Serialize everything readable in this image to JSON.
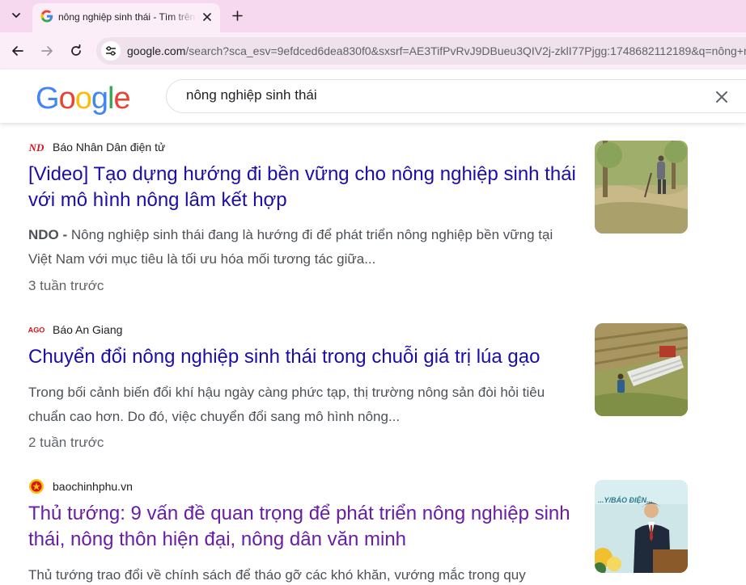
{
  "browser": {
    "tab_title": "nông nghiệp sinh thái - Tìm trên Google",
    "url_host": "google.com",
    "url_rest": "/search?sca_esv=9efdced6dea830f0&sxsrf=AE3TifPvRvJ9DBueu3QIV2j-zklI77Pjgg:1748682112189&q=nông+nghiệp"
  },
  "google": {
    "logo_letters": [
      "G",
      "o",
      "o",
      "g",
      "l",
      "e"
    ],
    "logo_colors": [
      "#4285F4",
      "#EA4335",
      "#FBBC05",
      "#4285F4",
      "#34A853",
      "#EA4335"
    ],
    "search_query": "nông nghiệp sinh thái"
  },
  "results": [
    {
      "source_logo_text": "ND",
      "source_name": "Báo Nhân Dân điện tử",
      "title": "[Video] Tạo dựng hướng đi bền vững cho nông nghiệp sinh thái với mô hình nông lâm kết hợp",
      "snippet_prefix": "NDO - ",
      "snippet": "Nông nghiệp sinh thái đang là hướng đi để phát triển nông nghiệp bền vững tại Việt Nam với mục tiêu là tối ưu hóa mối tương tác giữa...",
      "date": "3 tuần trước"
    },
    {
      "source_logo_text": "AGO",
      "source_name": "Báo An Giang",
      "title": "Chuyển đổi nông nghiệp sinh thái trong chuỗi giá trị lúa gạo",
      "snippet": "Trong bối cảnh biến đổi khí hậu ngày càng phức tạp, thị trường nông sản đòi hỏi tiêu chuẩn cao hơn. Do đó, việc chuyển đổi sang mô hình nông...",
      "date": "2 tuần trước"
    },
    {
      "source_name": "baochinhphu.vn",
      "title": "Thủ tướng: 9 vấn đề quan trọng để phát triển nông nghiệp sinh thái, nông thôn hiện đại, nông dân văn minh",
      "snippet": "Thủ tướng trao đổi về chính sách để tháo gỡ các khó khăn, vướng mắc trong quy",
      "thumb_text": "...Y/BÁO ĐIỆN..."
    }
  ],
  "colors": {
    "tabstrip": "#f6d9ef",
    "link": "#1a0dab",
    "visited_link": "#681da8"
  }
}
